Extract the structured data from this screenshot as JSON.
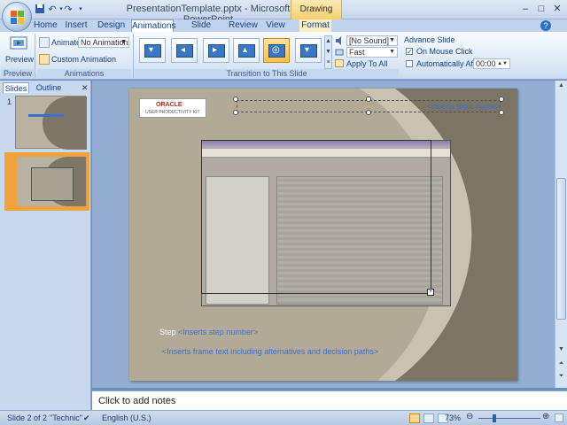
{
  "window": {
    "title": "PresentationTemplate.pptx - Microsoft PowerPoint",
    "context_tab": "Drawing Tools"
  },
  "tabs": [
    "Home",
    "Insert",
    "Design",
    "Animations",
    "Slide Show",
    "Review",
    "View",
    "Format"
  ],
  "active_tab": "Animations",
  "ribbon": {
    "preview_label": "Preview",
    "preview_group": "Preview",
    "animate_label": "Animate:",
    "animate_value": "No Animation",
    "custom_animation": "Custom Animation",
    "animations_group": "Animations",
    "sound_value": "[No Sound]",
    "speed_value": "Fast",
    "apply_to_all": "Apply To All",
    "transition_group": "Transition to This Slide",
    "advance_slide": "Advance Slide",
    "on_mouse_click": "On Mouse Click",
    "on_mouse_click_checked": true,
    "auto_after": "Automatically After:",
    "auto_after_checked": false,
    "auto_after_value": "00:00"
  },
  "panel": {
    "tabs": [
      "Slides",
      "Outline"
    ],
    "active_tab": "Slides",
    "slide_numbers": [
      "1",
      "2"
    ],
    "selected_slide": 2
  },
  "slide": {
    "logo_line1": "ORACLE",
    "logo_line2": "USER PRODUCTIVITY KIT",
    "topic_placeholder": "<Inserts topic name>",
    "step_label": "Step",
    "step_placeholder": "<Inserts step number>",
    "frame_text": "<Inserts frame text including alternatives and decision paths>"
  },
  "notes_placeholder": "Click to add notes",
  "status": {
    "slide_info": "Slide 2 of 2",
    "theme": "\"Technic\"",
    "language": "English (U.S.)",
    "zoom": "73%"
  },
  "colors": {
    "ribbon_tab_text": "#15428b",
    "slide_bg": "#b2aa97",
    "placeholder_text": "#3b6fd0",
    "selection_orange": "#f1a33b"
  }
}
